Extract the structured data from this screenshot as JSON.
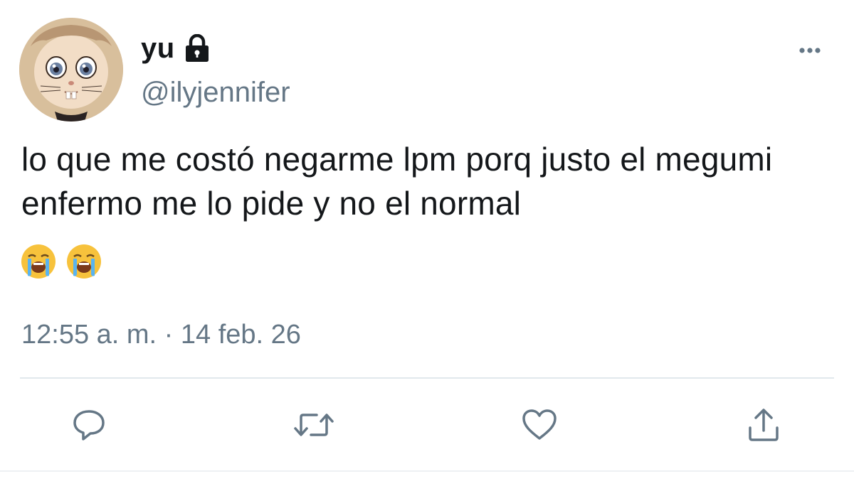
{
  "user": {
    "display_name": "yu",
    "handle": "@ilyjennifer",
    "protected_icon": "lock-icon",
    "avatar_icon": "avatar"
  },
  "tweet": {
    "text": "lo que me costó negarme lpm porq justo el megumi enfermo me lo pide y no el normal",
    "emojis": [
      "loudly-crying-face",
      "loudly-crying-face"
    ],
    "timestamp": "12:55 a. m. · 14 feb. 26"
  },
  "actions": {
    "reply_icon": "reply-icon",
    "retweet_icon": "retweet-icon",
    "like_icon": "heart-icon",
    "share_icon": "share-icon"
  },
  "colors": {
    "text_primary": "#14171a",
    "text_secondary": "#657786",
    "icon": "#657786",
    "divider": "#e1e8ed"
  }
}
